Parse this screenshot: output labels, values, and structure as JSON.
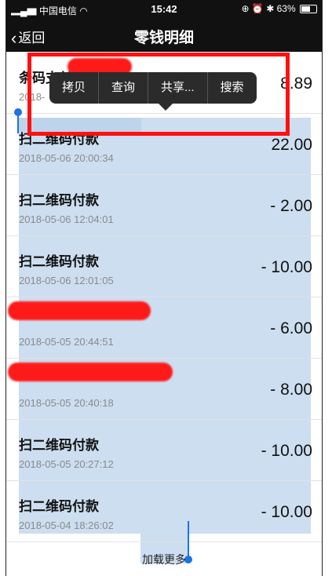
{
  "status": {
    "carrier": "中国电信",
    "time": "15:42",
    "battery": "63%",
    "battery_level": 0.63
  },
  "nav": {
    "back_label": "返回",
    "title": "零钱明细"
  },
  "context_menu": [
    "拷贝",
    "查询",
    "共享...",
    "搜索"
  ],
  "rows": [
    {
      "name": "条码支付",
      "date": "2018-",
      "amount": "8.89"
    },
    {
      "name": "扫二维码付款",
      "date": "2018-05-06 20:00:34",
      "amount": "22.00"
    },
    {
      "name": "扫二维码付款",
      "date": "2018-05-06 12:04:01",
      "amount": "- 2.00"
    },
    {
      "name": "扫二维码付款",
      "date": "2018-05-06 12:01:05",
      "amount": "- 10.00"
    },
    {
      "name": "",
      "date": "2018-05-05 20:44:51",
      "amount": "- 6.00"
    },
    {
      "name": "",
      "date": "2018-05-05 20:40:18",
      "amount": "- 8.00"
    },
    {
      "name": "扫二维码付款",
      "date": "2018-05-05 20:27:12",
      "amount": "- 10.00"
    },
    {
      "name": "扫二维码付款",
      "date": "2018-05-04 18:26:02",
      "amount": "- 10.00"
    }
  ],
  "load_more": "加载更多",
  "colors": {
    "selection": "#b6d0ea",
    "annotation_red": "#ff1010",
    "handle_blue": "#1a73e8"
  }
}
